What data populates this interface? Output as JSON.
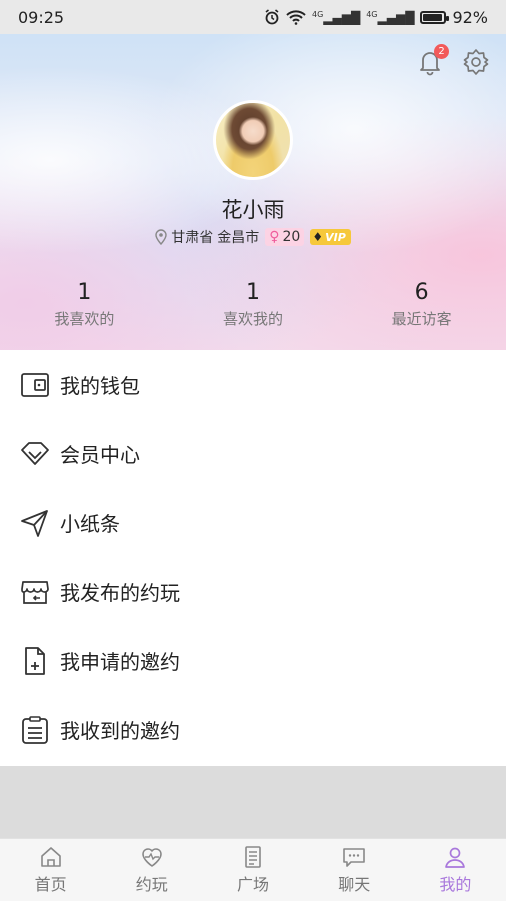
{
  "status_bar": {
    "time": "09:25",
    "network_1": "4G",
    "network_2": "4G",
    "battery": "92%",
    "battery_level": 0.92
  },
  "header": {
    "notification_count": "2",
    "user_name": "花小雨",
    "province": "甘肃省",
    "city": "金昌市",
    "gender_symbol": "♀",
    "age": "20",
    "vip_label": "VIP",
    "stats": [
      {
        "value": "1",
        "label": "我喜欢的"
      },
      {
        "value": "1",
        "label": "喜欢我的"
      },
      {
        "value": "6",
        "label": "最近访客"
      }
    ]
  },
  "menu": {
    "items": [
      {
        "label": "我的钱包",
        "icon": "wallet-icon"
      },
      {
        "label": "会员中心",
        "icon": "diamond-icon"
      },
      {
        "label": "小纸条",
        "icon": "send-icon"
      },
      {
        "label": "我发布的约玩",
        "icon": "store-icon"
      },
      {
        "label": "我申请的邀约",
        "icon": "file-add-icon"
      },
      {
        "label": "我收到的邀约",
        "icon": "clipboard-icon"
      }
    ]
  },
  "bottom_nav": {
    "items": [
      {
        "label": "首页",
        "icon": "home-icon",
        "active": false
      },
      {
        "label": "约玩",
        "icon": "heart-pulse-icon",
        "active": false
      },
      {
        "label": "广场",
        "icon": "document-stack-icon",
        "active": false
      },
      {
        "label": "聊天",
        "icon": "chat-icon",
        "active": false
      },
      {
        "label": "我的",
        "icon": "user-icon",
        "active": true
      }
    ],
    "active_color": "#a978dc",
    "inactive_color": "#777777"
  }
}
